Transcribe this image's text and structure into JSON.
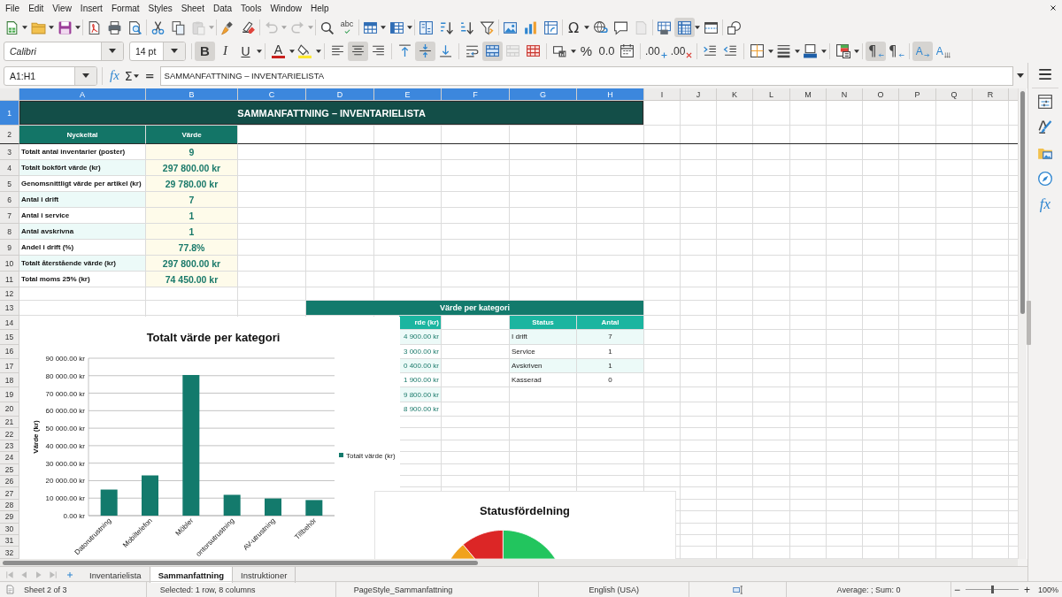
{
  "menu": [
    "File",
    "Edit",
    "View",
    "Insert",
    "Format",
    "Styles",
    "Sheet",
    "Data",
    "Tools",
    "Window",
    "Help"
  ],
  "standard_toolbar": {
    "paste": {
      "disabled": true
    },
    "undo": {
      "disabled": true
    },
    "redo": {
      "disabled": true
    },
    "spelling": {
      "label": "abc"
    },
    "special_character": {
      "label": "Ω"
    },
    "headers_footers": {
      "disabled": true
    },
    "freeze": {
      "on": true
    }
  },
  "formatting_toolbar": {
    "font_name": "Calibri",
    "font_size": "14 pt",
    "bold": {
      "label": "B",
      "on": true
    },
    "italic": {
      "label": "I",
      "on": false
    },
    "underline": {
      "label": "U",
      "on": false
    },
    "font_color": {
      "label": "A"
    },
    "align_left": {
      "on": false
    },
    "align_center": {
      "on": true
    },
    "align_right": {
      "on": false
    },
    "align_top": {
      "on": false
    },
    "align_middle": {
      "on": true
    },
    "align_bottom": {
      "on": false
    },
    "wrap_text": {
      "on": false
    },
    "merge_center": {
      "on": true
    },
    "merge": {
      "disabled": true
    },
    "percent": {
      "label": "%"
    },
    "standard_format": {
      "label": "0.0"
    },
    "add_decimal": {
      "label": ".00"
    },
    "delete_decimal": {
      "label": ".00"
    },
    "left_to_right": {
      "label": "¶",
      "on": true
    },
    "right_to_left": {
      "label": "¶",
      "on": false
    },
    "text_left_to_right": {
      "label": "A",
      "on": true
    },
    "text_vertical": {
      "label": "A",
      "on": false
    }
  },
  "formula_bar": {
    "name_box": "A1:H1",
    "function_wizard": "fx",
    "sum": "Σ",
    "formula": "=",
    "content": "SAMMANFATTNING – INVENTARIELISTA"
  },
  "sidebar": {
    "functions": "fx"
  },
  "sheet": {
    "columns": [
      {
        "label": "A",
        "selected": true
      },
      {
        "label": "B",
        "selected": true
      },
      {
        "label": "C",
        "selected": true
      },
      {
        "label": "D",
        "selected": true
      },
      {
        "label": "E",
        "selected": true
      },
      {
        "label": "F",
        "selected": true
      },
      {
        "label": "G",
        "selected": true
      },
      {
        "label": "H",
        "selected": true
      },
      {
        "label": "I",
        "selected": false
      },
      {
        "label": "J",
        "selected": false
      },
      {
        "label": "K",
        "selected": false
      },
      {
        "label": "L",
        "selected": false
      },
      {
        "label": "M",
        "selected": false
      },
      {
        "label": "N",
        "selected": false
      },
      {
        "label": "O",
        "selected": false
      },
      {
        "label": "P",
        "selected": false
      },
      {
        "label": "Q",
        "selected": false
      },
      {
        "label": "R",
        "selected": false
      }
    ],
    "rows": [
      {
        "label": "1",
        "selected": true
      },
      {
        "label": "2",
        "selected": false
      },
      {
        "label": "3",
        "selected": false
      },
      {
        "label": "4",
        "selected": false
      },
      {
        "label": "5",
        "selected": false
      },
      {
        "label": "6",
        "selected": false
      },
      {
        "label": "7",
        "selected": false
      },
      {
        "label": "8",
        "selected": false
      },
      {
        "label": "9",
        "selected": false
      },
      {
        "label": "10",
        "selected": false
      },
      {
        "label": "11",
        "selected": false
      },
      {
        "label": "12",
        "selected": false
      },
      {
        "label": "13",
        "selected": false
      },
      {
        "label": "14",
        "selected": false
      },
      {
        "label": "15",
        "selected": false
      },
      {
        "label": "16",
        "selected": false
      },
      {
        "label": "17",
        "selected": false
      },
      {
        "label": "18",
        "selected": false
      },
      {
        "label": "19",
        "selected": false
      },
      {
        "label": "20",
        "selected": false
      },
      {
        "label": "21",
        "selected": false
      },
      {
        "label": "22",
        "selected": false
      },
      {
        "label": "23",
        "selected": false
      },
      {
        "label": "24",
        "selected": false
      },
      {
        "label": "25",
        "selected": false
      },
      {
        "label": "26",
        "selected": false
      },
      {
        "label": "27",
        "selected": false
      },
      {
        "label": "28",
        "selected": false
      },
      {
        "label": "29",
        "selected": false
      },
      {
        "label": "30",
        "selected": false
      },
      {
        "label": "31",
        "selected": false
      },
      {
        "label": "32",
        "selected": false
      }
    ],
    "title": {
      "text": "SAMMANFATTNING – INVENTARIELISTA",
      "selected": true
    },
    "kpi_table": {
      "headers": [
        "Nyckeltal",
        "Värde"
      ],
      "rows": [
        {
          "label": "Totalt antal inventarier (poster)",
          "value": "9"
        },
        {
          "label": "Totalt bokfört värde (kr)",
          "value": "297 800.00 kr"
        },
        {
          "label": "Genomsnittligt värde per artikel (kr)",
          "value": "29 780.00 kr"
        },
        {
          "label": "Antal i drift",
          "value": "7"
        },
        {
          "label": "Antal i service",
          "value": "1"
        },
        {
          "label": "Antal avskrivna",
          "value": "1"
        },
        {
          "label": "Andel i drift (%)",
          "value": "77.8%"
        },
        {
          "label": "Totalt återstående värde (kr)",
          "value": "297 800.00 kr"
        },
        {
          "label": "Total moms 25% (kr)",
          "value": "74 450.00 kr"
        }
      ]
    },
    "category_table": {
      "title": "Värde per kategori",
      "header": "rde (kr)",
      "values": [
        "4 900.00 kr",
        "3 000.00 kr",
        "0 400.00 kr",
        "1 900.00 kr",
        "9 800.00 kr",
        "8 900.00 kr"
      ]
    },
    "status_table": {
      "headers": [
        "Status",
        "Antal"
      ],
      "rows": [
        {
          "status": "I drift",
          "count": "7"
        },
        {
          "status": "Service",
          "count": "1"
        },
        {
          "status": "Avskriven",
          "count": "1"
        },
        {
          "status": "Kasserad",
          "count": "0"
        }
      ]
    },
    "value_chart": {
      "chart_data": {
        "type": "bar",
        "title": "Totalt värde per kategori",
        "ylabel": "Värde (kr)",
        "categories": [
          "Datorutrustning",
          "Mobiltelefon",
          "Möbler",
          "ontorsutrustning",
          "AV-utrustning",
          "Tillbehör"
        ],
        "series": [
          {
            "name": "Totalt värde (kr)",
            "color": "#137a6c",
            "values": [
              14900,
              23000,
              80400,
              11900,
              9800,
              8900
            ]
          }
        ],
        "ylim": [
          0,
          90000
        ],
        "yticks": [
          {
            "value": 0,
            "label": "0.00 kr"
          },
          {
            "value": 10000,
            "label": "10 000.00 kr"
          },
          {
            "value": 20000,
            "label": "20 000.00 kr"
          },
          {
            "value": 30000,
            "label": "30 000.00 kr"
          },
          {
            "value": 40000,
            "label": "40 000.00 kr"
          },
          {
            "value": 50000,
            "label": "50 000.00 kr"
          },
          {
            "value": 60000,
            "label": "60 000.00 kr"
          },
          {
            "value": 70000,
            "label": "70 000.00 kr"
          },
          {
            "value": 80000,
            "label": "80 000.00 kr"
          },
          {
            "value": 90000,
            "label": "90 000.00 kr"
          }
        ],
        "grid": true
      }
    },
    "status_chart": {
      "title": "Statusfördelning"
    }
  },
  "sheet_navigation": {
    "disabled": true
  },
  "sheet_tabs": [
    {
      "label": "Inventarielista",
      "selected": false
    },
    {
      "label": "Sammanfattning",
      "selected": true
    },
    {
      "label": "Instruktioner",
      "selected": false
    }
  ],
  "status_bar": {
    "sheet": "Sheet 2 of 3",
    "selection": "Selected: 1 row, 8 columns",
    "page_style": "PageStyle_Sammanfattning",
    "language": "English (USA)",
    "summary": "Average: ; Sum: 0",
    "zoom_out": "−",
    "zoom": {
      "level": 0.5
    },
    "zoom_in": "+",
    "zoom_level": "100%"
  }
}
